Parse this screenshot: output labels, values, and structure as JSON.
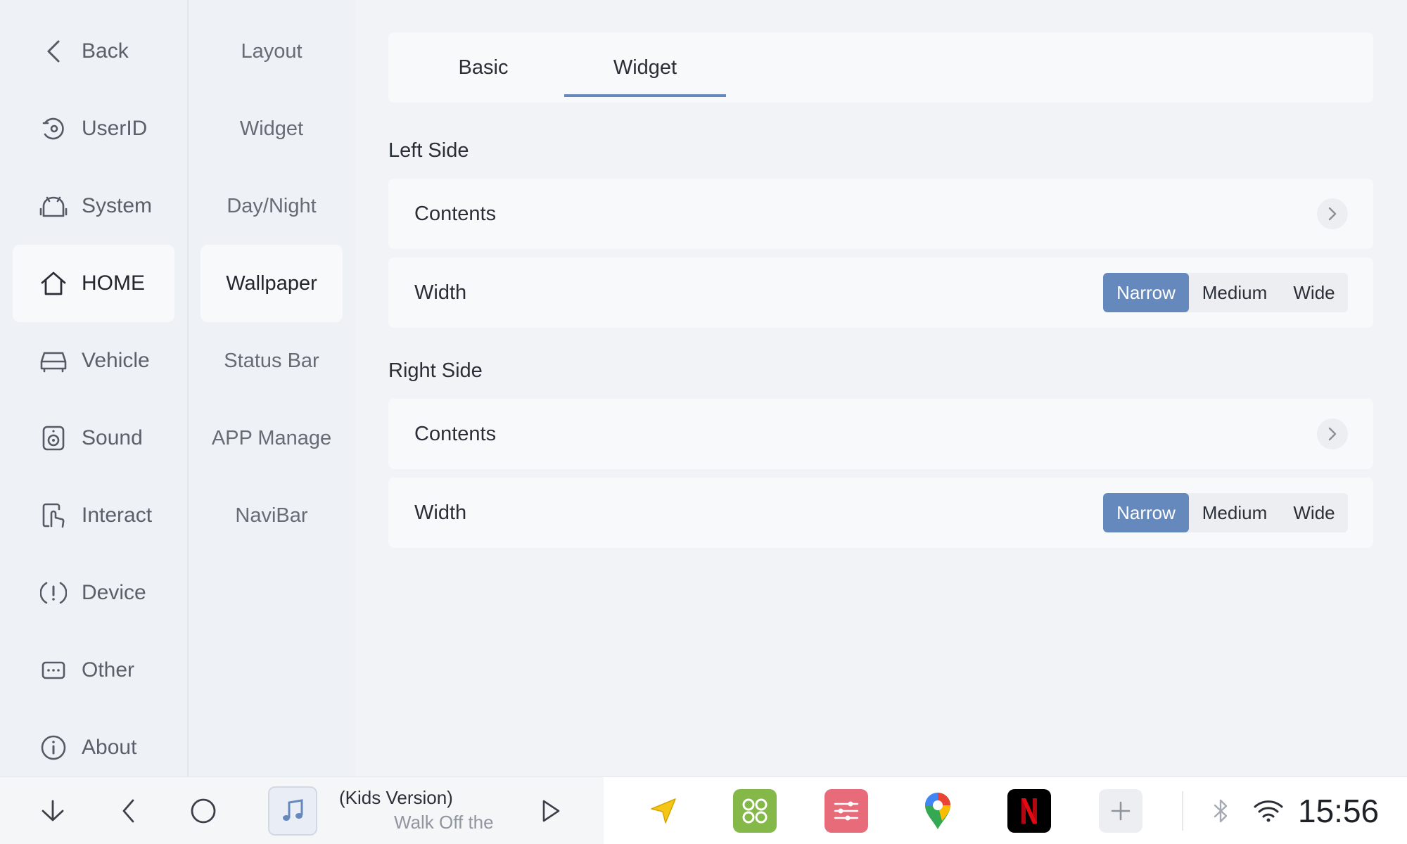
{
  "sidebar": {
    "items": [
      {
        "label": "Back",
        "icon": "chevron-left-icon"
      },
      {
        "label": "UserID",
        "icon": "user-id-icon"
      },
      {
        "label": "System",
        "icon": "android-icon"
      },
      {
        "label": "HOME",
        "icon": "home-icon",
        "active": true
      },
      {
        "label": "Vehicle",
        "icon": "car-icon"
      },
      {
        "label": "Sound",
        "icon": "speaker-icon"
      },
      {
        "label": "Interact",
        "icon": "touch-icon"
      },
      {
        "label": "Device",
        "icon": "alert-icon"
      },
      {
        "label": "Other",
        "icon": "more-icon"
      },
      {
        "label": "About",
        "icon": "info-icon"
      }
    ]
  },
  "submenu": {
    "items": [
      {
        "label": "Layout"
      },
      {
        "label": "Widget"
      },
      {
        "label": "Day/Night"
      },
      {
        "label": "Wallpaper",
        "active": true
      },
      {
        "label": "Status Bar"
      },
      {
        "label": "APP Manage"
      },
      {
        "label": "NaviBar"
      }
    ]
  },
  "tabs": [
    {
      "label": "Basic"
    },
    {
      "label": "Widget",
      "active": true
    }
  ],
  "left_side": {
    "title": "Left Side",
    "contents_label": "Contents",
    "width_label": "Width",
    "options": [
      "Narrow",
      "Medium",
      "Wide"
    ],
    "selected": "Narrow"
  },
  "right_side": {
    "title": "Right Side",
    "contents_label": "Contents",
    "width_label": "Width",
    "options": [
      "Narrow",
      "Medium",
      "Wide"
    ],
    "selected": "Narrow"
  },
  "bottombar": {
    "track_title": "(Kids Version)",
    "track_artist": "Walk Off the",
    "clock": "15:56",
    "accent": "#6589bd"
  }
}
